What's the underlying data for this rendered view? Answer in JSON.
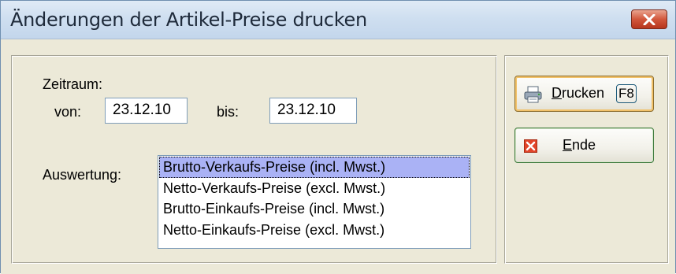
{
  "window": {
    "title": "Änderungen der Artikel-Preise drucken",
    "close_label": "close"
  },
  "form": {
    "period_label": "Zeitraum:",
    "from_label": "von:",
    "from_value": "23.12.10",
    "to_label": "bis:",
    "to_value": "23.12.10",
    "evaluation_label": "Auswertung:",
    "evaluation_options": [
      "Brutto-Verkaufs-Preise (incl. Mwst.)",
      "Netto-Verkaufs-Preise (excl. Mwst.)",
      "Brutto-Einkaufs-Preise (incl. Mwst.)",
      "Netto-Einkaufs-Preise (excl. Mwst.)"
    ],
    "selected_option": "Brutto-Verkaufs-Preise (incl. Mwst.)"
  },
  "buttons": {
    "print_label_first": "D",
    "print_label_rest": "rucken",
    "print_shortcut": "F8",
    "end_label_first": "E",
    "end_label_rest": "nde"
  },
  "icons": {
    "print": "printer-icon",
    "end": "close-red-square-icon",
    "close": "close-icon"
  },
  "colors": {
    "selection": "#aab2f5",
    "dialog_bg": "#ece9d8",
    "titlebar": "#cfdff0",
    "close_button": "#d2573c"
  }
}
